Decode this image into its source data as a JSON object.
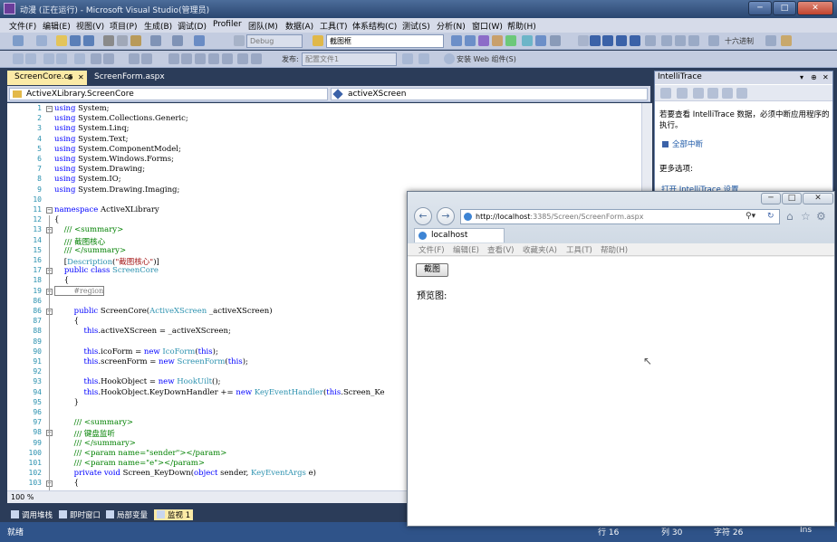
{
  "title_bar": {
    "title": "动漫 (正在运行) - Microsoft Visual Studio(管理员)",
    "minimize": "─",
    "maximize": "□",
    "close": "✕"
  },
  "menu": [
    "文件(F)",
    "编辑(E)",
    "视图(V)",
    "项目(P)",
    "生成(B)",
    "调试(D)",
    "Profiler",
    "团队(M)",
    "数据(A)",
    "工具(T)",
    "体系结构(C)",
    "测试(S)",
    "分析(N)",
    "窗口(W)",
    "帮助(H)"
  ],
  "toolbar1": {
    "config": "Debug",
    "find_combo": "截图框",
    "hex_label": "十六进制"
  },
  "toolbar2": {
    "publish_label": "发布:",
    "publish_combo": "配置文件1",
    "install_label": "安装 Web 组件(S)"
  },
  "tabs": [
    {
      "label": "ScreenCore.cs",
      "pin": "⊕",
      "close": "✕"
    },
    {
      "label": "ScreenForm.aspx"
    }
  ],
  "nav": {
    "left": "ActiveXLibrary.ScreenCore",
    "right": "activeXScreen"
  },
  "code_lines": [
    {
      "n": "1",
      "parts": [
        {
          "t": "using",
          "c": "kw"
        },
        {
          "t": " System;",
          "c": ""
        }
      ]
    },
    {
      "n": "2",
      "parts": [
        {
          "t": "using",
          "c": "kw"
        },
        {
          "t": " System.Collections.Generic;",
          "c": ""
        }
      ]
    },
    {
      "n": "3",
      "parts": [
        {
          "t": "using",
          "c": "kw"
        },
        {
          "t": " System.Linq;",
          "c": ""
        }
      ]
    },
    {
      "n": "4",
      "parts": [
        {
          "t": "using",
          "c": "kw"
        },
        {
          "t": " System.Text;",
          "c": ""
        }
      ]
    },
    {
      "n": "5",
      "parts": [
        {
          "t": "using",
          "c": "kw"
        },
        {
          "t": " System.ComponentModel;",
          "c": ""
        }
      ]
    },
    {
      "n": "6",
      "parts": [
        {
          "t": "using",
          "c": "kw"
        },
        {
          "t": " System.Windows.Forms;",
          "c": ""
        }
      ]
    },
    {
      "n": "7",
      "parts": [
        {
          "t": "using",
          "c": "kw"
        },
        {
          "t": " System.Drawing;",
          "c": ""
        }
      ]
    },
    {
      "n": "8",
      "parts": [
        {
          "t": "using",
          "c": "kw"
        },
        {
          "t": " System.IO;",
          "c": ""
        }
      ]
    },
    {
      "n": "9",
      "parts": [
        {
          "t": "using",
          "c": "kw"
        },
        {
          "t": " System.Drawing.Imaging;",
          "c": ""
        }
      ]
    },
    {
      "n": "10",
      "parts": []
    },
    {
      "n": "11",
      "parts": [
        {
          "t": "namespace",
          "c": "kw"
        },
        {
          "t": " ActiveXLibrary",
          "c": ""
        }
      ]
    },
    {
      "n": "12",
      "parts": [
        {
          "t": "{",
          "c": ""
        }
      ]
    },
    {
      "n": "13",
      "parts": [
        {
          "t": "    /// <summary>",
          "c": "cm"
        }
      ]
    },
    {
      "n": "14",
      "parts": [
        {
          "t": "    /// 截图核心",
          "c": "cm"
        }
      ]
    },
    {
      "n": "15",
      "parts": [
        {
          "t": "    /// </summary>",
          "c": "cm"
        }
      ]
    },
    {
      "n": "16",
      "parts": [
        {
          "t": "    [",
          "c": ""
        },
        {
          "t": "Description",
          "c": "ty"
        },
        {
          "t": "(",
          "c": ""
        },
        {
          "t": "\"截图核心\"",
          "c": "st"
        },
        {
          "t": ")]",
          "c": ""
        }
      ]
    },
    {
      "n": "17",
      "parts": [
        {
          "t": "    ",
          "c": ""
        },
        {
          "t": "public class",
          "c": "kw"
        },
        {
          "t": " ",
          "c": ""
        },
        {
          "t": "ScreenCore",
          "c": "ty"
        }
      ]
    },
    {
      "n": "18",
      "parts": [
        {
          "t": "    {",
          "c": ""
        }
      ]
    },
    {
      "n": "19",
      "parts": [
        {
          "t": "        #region",
          "c": "region"
        }
      ]
    },
    {
      "n": "86",
      "parts": []
    },
    {
      "n": "86",
      "parts": [
        {
          "t": "        ",
          "c": ""
        },
        {
          "t": "public",
          "c": "kw"
        },
        {
          "t": " ScreenCore(",
          "c": ""
        },
        {
          "t": "ActiveXScreen",
          "c": "ty"
        },
        {
          "t": " _activeXScreen)",
          "c": ""
        }
      ]
    },
    {
      "n": "87",
      "parts": [
        {
          "t": "        {",
          "c": ""
        }
      ]
    },
    {
      "n": "88",
      "parts": [
        {
          "t": "            ",
          "c": ""
        },
        {
          "t": "this",
          "c": "kw"
        },
        {
          "t": ".activeXScreen = _activeXScreen;",
          "c": ""
        }
      ]
    },
    {
      "n": "89",
      "parts": []
    },
    {
      "n": "90",
      "parts": [
        {
          "t": "            ",
          "c": ""
        },
        {
          "t": "this",
          "c": "kw"
        },
        {
          "t": ".icoForm = ",
          "c": ""
        },
        {
          "t": "new",
          "c": "kw"
        },
        {
          "t": " ",
          "c": ""
        },
        {
          "t": "IcoForm",
          "c": "ty"
        },
        {
          "t": "(",
          "c": ""
        },
        {
          "t": "this",
          "c": "kw"
        },
        {
          "t": ");",
          "c": ""
        }
      ]
    },
    {
      "n": "91",
      "parts": [
        {
          "t": "            ",
          "c": ""
        },
        {
          "t": "this",
          "c": "kw"
        },
        {
          "t": ".screenForm = ",
          "c": ""
        },
        {
          "t": "new",
          "c": "kw"
        },
        {
          "t": " ",
          "c": ""
        },
        {
          "t": "ScreenForm",
          "c": "ty"
        },
        {
          "t": "(",
          "c": ""
        },
        {
          "t": "this",
          "c": "kw"
        },
        {
          "t": ");",
          "c": ""
        }
      ]
    },
    {
      "n": "92",
      "parts": []
    },
    {
      "n": "93",
      "parts": [
        {
          "t": "            ",
          "c": ""
        },
        {
          "t": "this",
          "c": "kw"
        },
        {
          "t": ".HookObject = ",
          "c": ""
        },
        {
          "t": "new",
          "c": "kw"
        },
        {
          "t": " ",
          "c": ""
        },
        {
          "t": "HookUilt",
          "c": "ty"
        },
        {
          "t": "();",
          "c": ""
        }
      ]
    },
    {
      "n": "94",
      "parts": [
        {
          "t": "            ",
          "c": ""
        },
        {
          "t": "this",
          "c": "kw"
        },
        {
          "t": ".HookObject.KeyDownHandler += ",
          "c": ""
        },
        {
          "t": "new",
          "c": "kw"
        },
        {
          "t": " ",
          "c": ""
        },
        {
          "t": "KeyEventHandler",
          "c": "ty"
        },
        {
          "t": "(",
          "c": ""
        },
        {
          "t": "this",
          "c": "kw"
        },
        {
          "t": ".Screen_Ke",
          "c": ""
        }
      ]
    },
    {
      "n": "95",
      "parts": [
        {
          "t": "        }",
          "c": ""
        }
      ]
    },
    {
      "n": "96",
      "parts": []
    },
    {
      "n": "97",
      "parts": [
        {
          "t": "        /// <summary>",
          "c": "cm"
        }
      ]
    },
    {
      "n": "98",
      "parts": [
        {
          "t": "        /// 键盘监听",
          "c": "cm"
        }
      ]
    },
    {
      "n": "99",
      "parts": [
        {
          "t": "        /// </summary>",
          "c": "cm"
        }
      ]
    },
    {
      "n": "100",
      "parts": [
        {
          "t": "        /// <param name=\"sender\"></param>",
          "c": "cm"
        }
      ]
    },
    {
      "n": "101",
      "parts": [
        {
          "t": "        /// <param name=\"e\"></param>",
          "c": "cm"
        }
      ]
    },
    {
      "n": "102",
      "parts": [
        {
          "t": "        ",
          "c": ""
        },
        {
          "t": "private void",
          "c": "kw"
        },
        {
          "t": " Screen_KeyDown(",
          "c": ""
        },
        {
          "t": "object",
          "c": "kw"
        },
        {
          "t": " sender, ",
          "c": ""
        },
        {
          "t": "KeyEventArgs",
          "c": "ty"
        },
        {
          "t": " e)",
          "c": ""
        }
      ]
    },
    {
      "n": "103",
      "parts": [
        {
          "t": "        {",
          "c": ""
        }
      ]
    }
  ],
  "zoom": "100 %",
  "bottom_tabs": [
    "调用堆栈",
    "即时窗口",
    "局部变量",
    "监视 1"
  ],
  "status": {
    "left": "就绪",
    "row": "行 16",
    "col": "列 30",
    "char": "字符 26",
    "mode": "Ins"
  },
  "intellitrace": {
    "title": "IntelliTrace",
    "message": "若要查看 IntelliTrace 数据，必须中断应用程序的执行。",
    "break_all": "全部中断",
    "more_options": "更多选项:",
    "open_settings": "打开 IntelliTrace 设置"
  },
  "browser": {
    "url_host": "http://localhost",
    "url_rest": ":3385/Screen/ScreenForm.aspx",
    "tab_title": "localhost",
    "menu": [
      "文件(F)",
      "编辑(E)",
      "查看(V)",
      "收藏夹(A)",
      "工具(T)",
      "帮助(H)"
    ],
    "button_label": "截图",
    "preview_label": "预览图:"
  },
  "colors": {
    "keyword": "#0000ff",
    "type": "#2b91af",
    "comment": "#008000",
    "string": "#a31515",
    "status_bar": "#2f5389"
  }
}
